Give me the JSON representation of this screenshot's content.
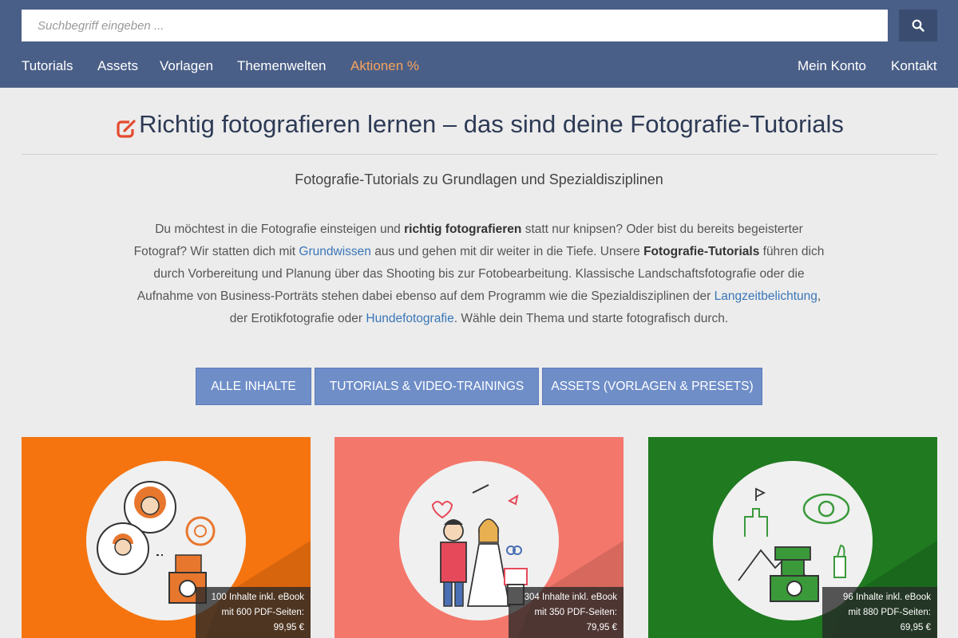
{
  "search": {
    "placeholder": "Suchbegriff eingeben ..."
  },
  "nav": {
    "left": [
      "Tutorials",
      "Assets",
      "Vorlagen",
      "Themenwelten",
      "Aktionen %"
    ],
    "right": [
      "Mein Konto",
      "Kontakt"
    ]
  },
  "page": {
    "title": "Richtig fotografieren lernen – das sind deine Fotografie-Tutorials",
    "subtitle": "Fotografie-Tutorials zu Grundlagen und Spezialdisziplinen",
    "intro": {
      "p1": "Du möchtest in die Fotografie einsteigen und ",
      "b1": "richtig fotografieren",
      "p2": " statt nur knipsen? Oder bist du bereits begeisterter Fotograf? Wir statten dich mit ",
      "l1": "Grundwissen",
      "p3": " aus und gehen mit dir weiter in die Tiefe. Unsere ",
      "b2": "Fotografie-Tutorials",
      "p4": " führen dich durch Vorbereitung und Planung über das Shooting bis zur Fotobearbeitung. Klassische Landschaftsfotografie oder die Aufnahme von Business-Porträts stehen dabei ebenso auf dem Programm wie die Spezialdisziplinen der ",
      "l2": "Langzeitbelichtung",
      "p5": ", der Erotikfotografie oder ",
      "l3": "Hundefotografie",
      "p6": ". Wähle dein Thema und starte fotografisch durch."
    }
  },
  "filters": [
    "ALLE INHALTE",
    "TUTORIALS & VIDEO-TRAININGS",
    "ASSETS (VORLAGEN & PRESETS)"
  ],
  "cards": [
    {
      "bg": "#f5740f",
      "line1": "100 Inhalte inkl. eBook",
      "line2": "mit 600 PDF-Seiten:",
      "price": "99,95 €"
    },
    {
      "bg": "#f4776b",
      "line1": "304 Inhalte inkl. eBook",
      "line2": "mit 350 PDF-Seiten:",
      "price": "79,95 €"
    },
    {
      "bg": "#1f7a20",
      "line1": "96 Inhalte inkl. eBook",
      "line2": "mit 880 PDF-Seiten:",
      "price": "69,95 €"
    }
  ],
  "colors": {
    "header": "#4a5f87",
    "accent": "#f7a35c",
    "filter_button": "#6f8ec8",
    "link": "#3a76b8"
  }
}
